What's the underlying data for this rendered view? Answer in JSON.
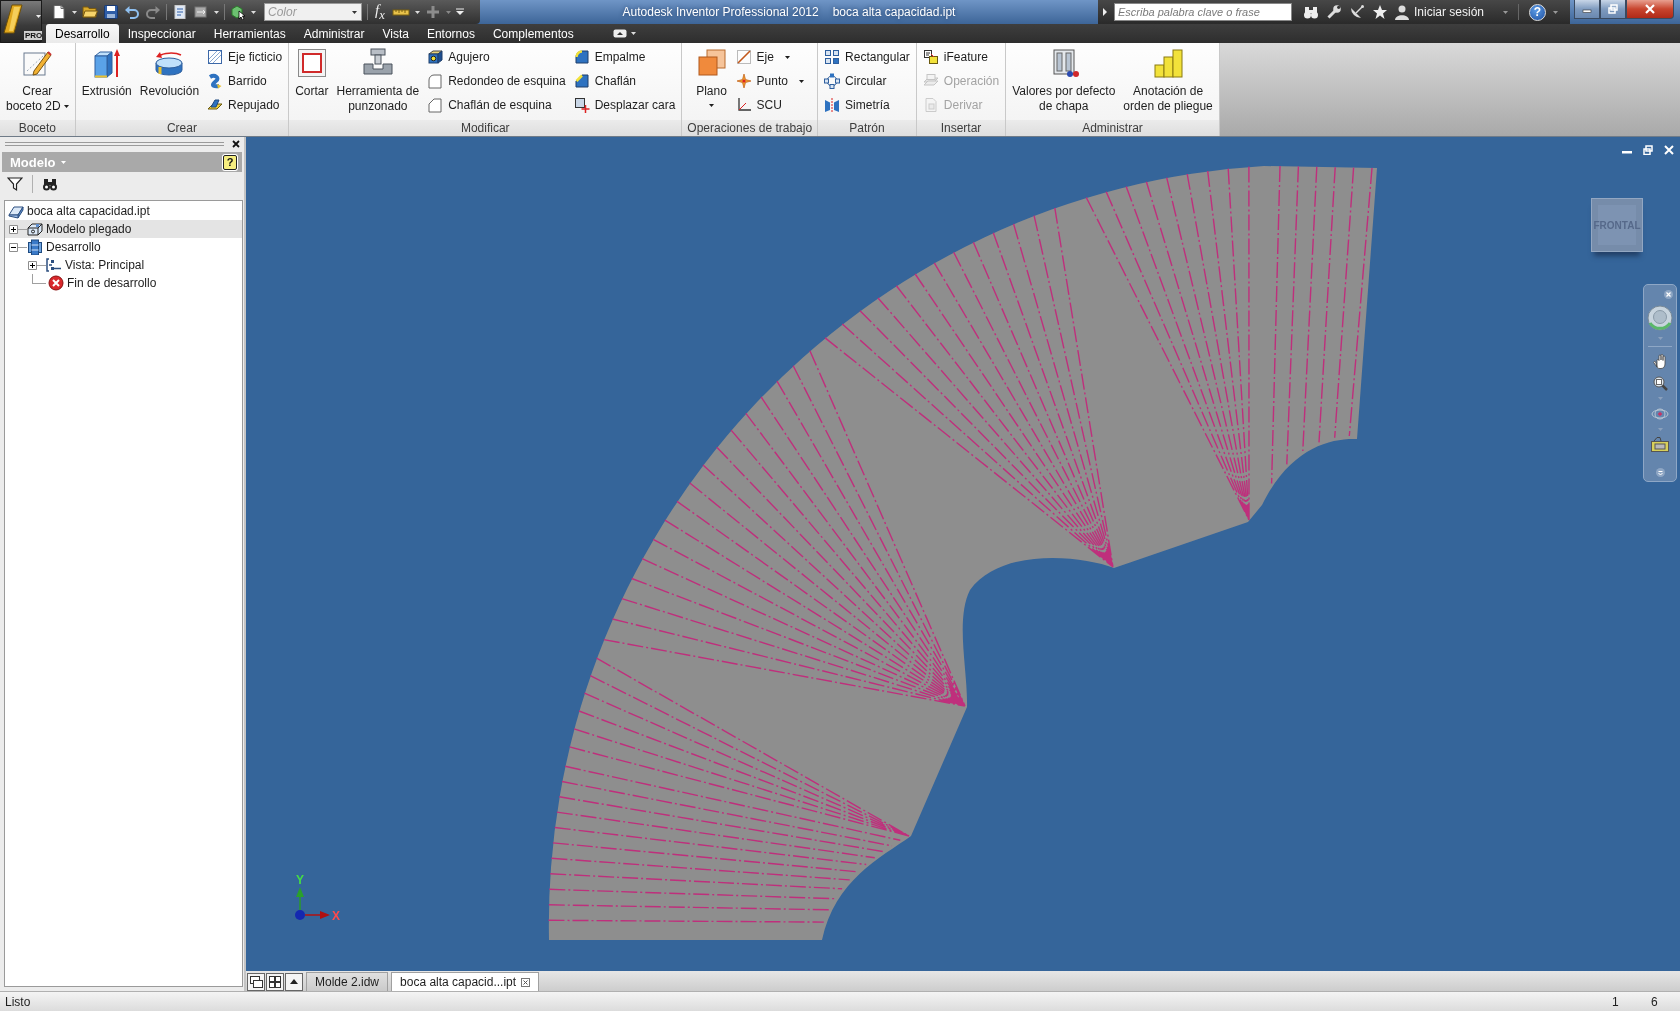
{
  "title_bar": {
    "app_button": {
      "label": "PRO"
    },
    "quick_access": {
      "color_field": {
        "placeholder": "Color"
      },
      "function_button": "f$_{x}$"
    },
    "title": "Autodesk Inventor Professional 2012",
    "document": "boca alta capacidad.ipt",
    "search": {
      "placeholder": "Escriba palabra clave o frase"
    },
    "sign_in": "Iniciar sesión",
    "help_button": "?"
  },
  "tabs": [
    {
      "label": "Desarrollo",
      "selected": true
    },
    {
      "label": "Inspeccionar",
      "selected": false
    },
    {
      "label": "Herramientas",
      "selected": false
    },
    {
      "label": "Administrar",
      "selected": false
    },
    {
      "label": "Vista",
      "selected": false
    },
    {
      "label": "Entornos",
      "selected": false
    },
    {
      "label": "Complementos",
      "selected": false
    }
  ],
  "ribbon": {
    "panels": [
      {
        "label": "Boceto",
        "groups": [
          {
            "kind": "large",
            "label": "Crear\nboceto 2D",
            "dropdown": true,
            "disabled": false
          }
        ]
      },
      {
        "label": "Crear",
        "groups": [
          {
            "kind": "large",
            "label": "Extrusión",
            "dropdown": false,
            "disabled": false
          },
          {
            "kind": "large",
            "label": "Revolución",
            "dropdown": false,
            "disabled": false
          },
          {
            "kind": "column",
            "tools": [
              {
                "label": "Eje ficticio",
                "dropdown": false,
                "disabled": false
              },
              {
                "label": "Barrido",
                "dropdown": false,
                "disabled": false
              },
              {
                "label": "Repujado",
                "dropdown": false,
                "disabled": false
              }
            ]
          }
        ]
      },
      {
        "label": "Modificar",
        "groups": [
          {
            "kind": "large",
            "label": "Cortar",
            "dropdown": false,
            "disabled": false
          },
          {
            "kind": "large",
            "label": "Herramienta de\npunzonado",
            "dropdown": false,
            "disabled": false
          },
          {
            "kind": "column",
            "tools": [
              {
                "label": "Agujero",
                "dropdown": false,
                "disabled": false
              },
              {
                "label": "Redondeo de esquina",
                "dropdown": false,
                "disabled": false
              },
              {
                "label": "Chaflán de esquina",
                "dropdown": false,
                "disabled": false
              }
            ]
          },
          {
            "kind": "column",
            "tools": [
              {
                "label": "Empalme",
                "dropdown": false,
                "disabled": false
              },
              {
                "label": "Chaflán",
                "dropdown": false,
                "disabled": false
              },
              {
                "label": "Desplazar cara",
                "dropdown": false,
                "disabled": false
              }
            ]
          }
        ]
      },
      {
        "label": "Operaciones de trabajo",
        "groups": [
          {
            "kind": "large",
            "label": "Plano",
            "dropdown": true,
            "disabled": false
          },
          {
            "kind": "column",
            "tools": [
              {
                "label": "Eje",
                "dropdown": true,
                "disabled": false
              },
              {
                "label": "Punto",
                "dropdown": true,
                "disabled": false
              },
              {
                "label": "SCU",
                "dropdown": false,
                "disabled": false
              }
            ]
          }
        ]
      },
      {
        "label": "Patrón",
        "groups": [
          {
            "kind": "column",
            "tools": [
              {
                "label": "Rectangular",
                "dropdown": false,
                "disabled": false
              },
              {
                "label": "Circular",
                "dropdown": false,
                "disabled": false
              },
              {
                "label": "Simetría",
                "dropdown": false,
                "disabled": false
              }
            ]
          }
        ]
      },
      {
        "label": "Insertar",
        "groups": [
          {
            "kind": "column",
            "tools": [
              {
                "label": "iFeature",
                "dropdown": false,
                "disabled": false
              },
              {
                "label": "Operación",
                "dropdown": false,
                "disabled": true
              },
              {
                "label": "Derivar",
                "dropdown": false,
                "disabled": true
              }
            ]
          }
        ]
      },
      {
        "label": "Administrar",
        "groups": [
          {
            "kind": "large",
            "label": "Valores por defecto\nde chapa",
            "dropdown": false,
            "disabled": false
          },
          {
            "kind": "large",
            "label": "Anotación de\norden de pliegue",
            "dropdown": false,
            "disabled": false
          }
        ]
      }
    ]
  },
  "browser": {
    "title": "Modelo",
    "help_button": "?",
    "tree": [
      {
        "label": "boca alta capacidad.ipt",
        "selected": false,
        "children": [
          {
            "label": "Modelo plegado",
            "selected": true,
            "expanded": false
          },
          {
            "label": "Desarrollo",
            "selected": false,
            "expanded": true,
            "children": [
              {
                "label": "Vista: Principal",
                "selected": false,
                "expanded": false
              },
              {
                "label": "Fin de desarrollo",
                "selected": false
              }
            ]
          }
        ]
      }
    ]
  },
  "viewport": {
    "view_cube": {
      "label": "FRONTAL"
    },
    "axes": {
      "x_label": "X",
      "y_label": "Y"
    }
  },
  "document_tabs": [
    {
      "label": "Molde 2.idw",
      "selected": false
    },
    {
      "label": "boca alta capacid...ipt",
      "selected": true
    }
  ],
  "status_bar": {
    "message": "Listo",
    "field_1": "1",
    "field_2": "6"
  }
}
